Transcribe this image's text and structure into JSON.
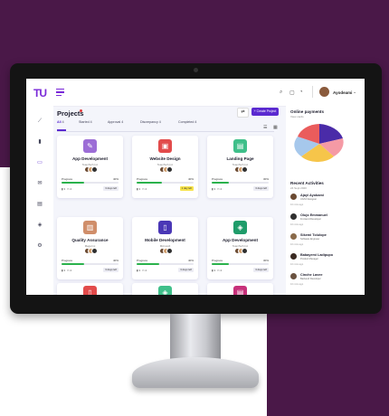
{
  "app": {
    "logo": "TU",
    "username": "Ayodeami"
  },
  "page": {
    "title": "Projects",
    "create_label": "+ Create Project"
  },
  "filters": [
    {
      "label": "All",
      "count": "4"
    },
    {
      "label": "Started",
      "count": "4"
    },
    {
      "label": "Approval",
      "count": "4"
    },
    {
      "label": "Discrepancy",
      "count": "4"
    },
    {
      "label": "Completed",
      "count": "4"
    }
  ],
  "cards": [
    {
      "title": "App Development",
      "sub": "TeamTech Inc",
      "progress_label": "Progress",
      "pct": "40%",
      "progress": 0.4,
      "meta1": "3",
      "meta2": "2",
      "due": "3 days left",
      "due_warn": false,
      "color": "#9c6dd6",
      "icon": "brush-icon"
    },
    {
      "title": "Website Design",
      "sub": "TeamTech Inc",
      "progress_label": "Progress",
      "pct": "40%",
      "progress": 0.45,
      "meta1": "3",
      "meta2": "2",
      "due": "1 day left",
      "due_warn": true,
      "color": "#e24b4b",
      "icon": "browser-icon"
    },
    {
      "title": "Landing Page",
      "sub": "TeamTech Inc",
      "progress_label": "Progress",
      "pct": "30%",
      "progress": 0.3,
      "meta1": "3",
      "meta2": "2",
      "due": "3 days left",
      "due_warn": false,
      "color": "#3fbf8a",
      "icon": "document-icon"
    },
    {
      "title": "Quality Assurance",
      "sub": "Mega Inc",
      "progress_label": "Progress",
      "pct": "40%",
      "progress": 0.4,
      "meta1": "3",
      "meta2": "2",
      "due": "3 days left",
      "due_warn": false,
      "color": "#d08e6a",
      "icon": "chart-icon"
    },
    {
      "title": "Mobile Development",
      "sub": "Microsoft",
      "progress_label": "Progress",
      "pct": "40%",
      "progress": 0.4,
      "meta1": "3",
      "meta2": "2",
      "due": "3 days left",
      "due_warn": false,
      "color": "#4a37b6",
      "icon": "phone-icon"
    },
    {
      "title": "App Development",
      "sub": "TeamTech Inc",
      "progress_label": "Progress",
      "pct": "30%",
      "progress": 0.3,
      "meta1": "3",
      "meta2": "2",
      "due": "3 days left",
      "due_warn": false,
      "color": "#1f9c6a",
      "icon": "layers-icon"
    }
  ],
  "panel": {
    "title": "Online payments",
    "sub": "View cards",
    "pie_colors": [
      "#4a2ba8",
      "#f59aa5",
      "#f6c54a",
      "#a6c8ec",
      "#ea5c5c"
    ],
    "activity_title": "Recent Activities",
    "activity_sub": "24 Sept 2020",
    "activities": [
      {
        "name": "Ajayi Ayobami",
        "desc": "UX/UI Designer",
        "time": "10 mins ago",
        "color": "#6b4a32"
      },
      {
        "name": "Olujo Emmanuel",
        "desc": "Frontend Developer",
        "time": "10 mins ago",
        "color": "#2f2f2f"
      },
      {
        "name": "Sikemi Tolulope",
        "desc": "Software Engineer",
        "time": "10 mins ago",
        "color": "#8a6a4a"
      },
      {
        "name": "Babayemi Ladipupo",
        "desc": "Product Manager",
        "time": "10 mins ago",
        "color": "#3a2a22"
      },
      {
        "name": "Cinche Lavee",
        "desc": "Backend Developer",
        "time": "10 mins ago",
        "color": "#6a5240"
      }
    ]
  }
}
